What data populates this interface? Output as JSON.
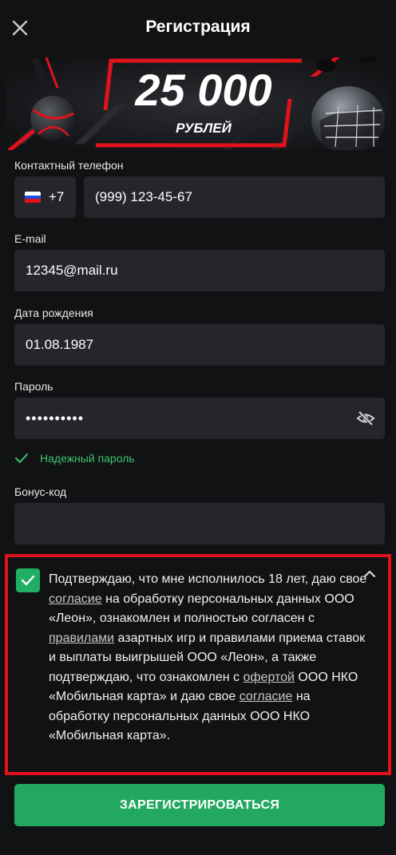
{
  "header": {
    "title": "Регистрация",
    "close_icon": "close-icon"
  },
  "banner": {
    "amount": "25 000",
    "currency": "РУБЛЕЙ",
    "accent_color": "#e0121b"
  },
  "form": {
    "phone": {
      "label": "Контактный телефон",
      "country_flag": "russia-flag-icon",
      "country_code": "+7",
      "value": "(999) 123-45-67"
    },
    "email": {
      "label": "E-mail",
      "value": "12345@mail.ru"
    },
    "birth_date": {
      "label": "Дата рождения",
      "value": "01.08.1987"
    },
    "password": {
      "label": "Пароль",
      "value": "••••••••••",
      "visibility_icon": "eye-off-icon",
      "strength_icon": "check-icon",
      "strength_text": "Надежный пароль",
      "strength_color": "#3cc36c"
    },
    "bonus_code": {
      "label": "Бонус-код",
      "value": ""
    }
  },
  "consent": {
    "checked": true,
    "checkbox_icon": "check-icon",
    "collapse_icon": "chevron-up-icon",
    "highlight_color": "#e0121b",
    "text_1": "Подтверждаю, что мне исполнилось 18 лет, даю свое ",
    "link_1": "согласие",
    "text_2": " на обработку персональных данных ООО «Леон», ознакомлен и полностью согласен с ",
    "link_2": "правилами",
    "text_3": " азартных игр и правилами приема ставок и выплаты выигрышей ООО «Леон», а также подтверждаю, что ознакомлен с ",
    "link_3": "офертой",
    "text_4": " ООО НКО «Мобильная карта» и даю свое ",
    "link_4": "согласие",
    "text_5": " на обработку персональных данных ООО НКО «Мобильная карта»."
  },
  "register_button": {
    "label": "ЗАРЕГИСТРИРОВАТЬСЯ",
    "color": "#22a861"
  }
}
